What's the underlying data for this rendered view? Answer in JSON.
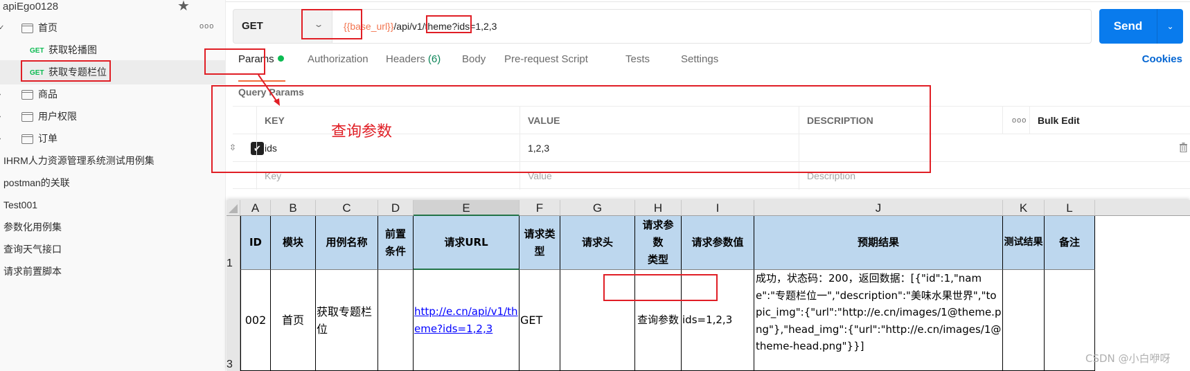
{
  "sidebar": {
    "workspace_title": "apiEgo0128",
    "star_icon": "star-icon",
    "tree": [
      {
        "type": "folder",
        "label": "首页",
        "expanded": true
      },
      {
        "type": "request",
        "method": "GET",
        "label": "获取轮播图"
      },
      {
        "type": "request",
        "method": "GET",
        "label": "获取专题栏位",
        "selected": true
      },
      {
        "type": "folder",
        "label": "商品"
      },
      {
        "type": "folder",
        "label": "用户权限"
      },
      {
        "type": "folder",
        "label": "订单"
      }
    ],
    "collections": [
      "IHRM人力资源管理系统测试用例集",
      "postman的关联",
      "Test001",
      "参数化用例集",
      "查询天气接口",
      "请求前置脚本"
    ]
  },
  "request": {
    "method": "GET",
    "url_variable": "{{base_url}}",
    "url_path": "/api/v1/theme?",
    "url_query": "ids=1,2,3",
    "send_label": "Send"
  },
  "tabs": [
    {
      "label": "Params",
      "active": true,
      "indicator": "green-dot"
    },
    {
      "label": "Authorization"
    },
    {
      "label": "Headers",
      "count": "(6)"
    },
    {
      "label": "Body"
    },
    {
      "label": "Pre-request Script"
    },
    {
      "label": "Tests"
    },
    {
      "label": "Settings"
    }
  ],
  "cookies_label": "Cookies",
  "query_params": {
    "title": "Query Params",
    "headers": {
      "key": "KEY",
      "value": "VALUE",
      "description": "DESCRIPTION",
      "bulk_edit": "Bulk Edit"
    },
    "rows": [
      {
        "checked": true,
        "key": "ids",
        "value": "1,2,3",
        "description": ""
      }
    ],
    "placeholders": {
      "key": "Key",
      "value": "Value",
      "description": "Description"
    }
  },
  "annotation": {
    "label": "查询参数",
    "color": "#e01e25"
  },
  "spreadsheet": {
    "columns": [
      "A",
      "B",
      "C",
      "D",
      "E",
      "F",
      "G",
      "H",
      "I",
      "J",
      "K",
      "L"
    ],
    "selected_column": "E",
    "header_row_number": "1",
    "data_row_number": "3",
    "headers": [
      "ID",
      "模块",
      "用例名称",
      "前置条件",
      "请求URL",
      "请求类型",
      "请求头",
      "请求参数类型",
      "请求参数值",
      "预期结果",
      "测试结果",
      "备注"
    ],
    "header_display": {
      "precondition": "前置\n条件",
      "request_type": "请求类\n型",
      "param_type": "请求参\n数\n类型"
    },
    "row": {
      "id": "002",
      "module": "首页",
      "case_name": "获取专题栏位",
      "precondition": "",
      "url": "http://e.cn/api/v1/theme?ids=1,2,3",
      "request_type": "GET",
      "request_headers": "",
      "param_type": "查询参数",
      "param_value": "ids=1,2,3",
      "expected": "成功，状态码：200，返回数据：[{\"id\":1,\"name\":\"专题栏位一\",\"description\":\"美味水果世界\",\"topic_img\":{\"url\":\"http://e.cn/images/1@theme.png\"},\"head_img\":{\"url\":\"http://e.cn/images/1@theme-head.png\"}}]",
      "test_result": "",
      "remark": ""
    }
  },
  "watermark": "CSDN @小白咿呀",
  "colors": {
    "send_button": "#097bed",
    "get_method": "#0cbb52",
    "url_variable": "#f2744f",
    "active_tab_underline": "#f26b3a",
    "excel_header_fill": "#bdd7ee",
    "annotation_red": "#e01e25"
  }
}
